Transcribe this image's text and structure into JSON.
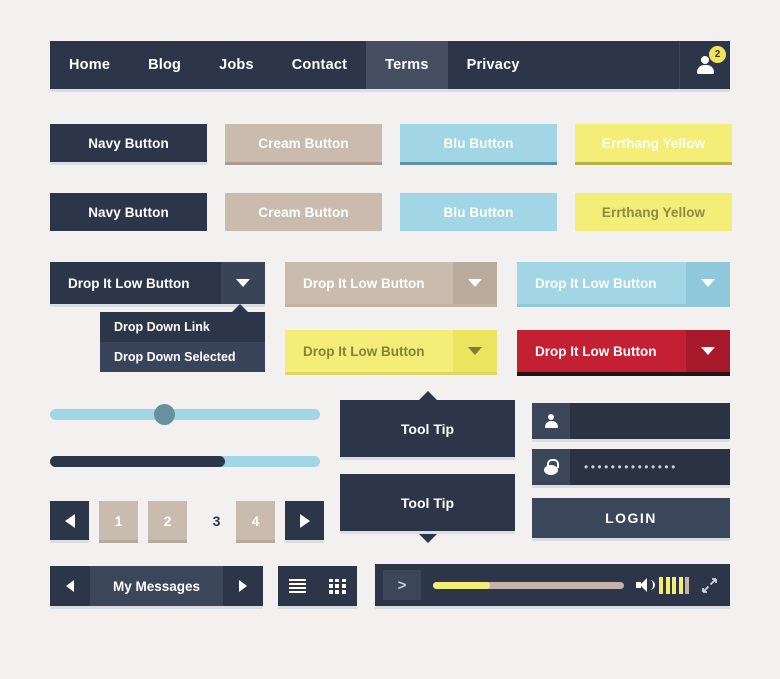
{
  "page": {
    "background": "#f2f1ef",
    "title": "Flat UI Kit"
  },
  "navbar": {
    "background": "#2c3648",
    "active_background": "#454f61",
    "items": [
      {
        "label": "Home",
        "active": false
      },
      {
        "label": "Blog",
        "active": false
      },
      {
        "label": "Jobs",
        "active": false
      },
      {
        "label": "Contact",
        "active": false
      },
      {
        "label": "Terms",
        "active": true
      },
      {
        "label": "Privacy",
        "active": false
      }
    ],
    "avatar": {
      "icon": "user-icon",
      "badge_count": "2",
      "badge_color": "#f2e35d"
    }
  },
  "buttons_row_one": [
    {
      "label": "Navy Button",
      "color": "#2c3648",
      "text_color": "#ffffff"
    },
    {
      "label": "Cream Button",
      "color": "#c9bcae",
      "text_color": "#ffffff"
    },
    {
      "label": "Blu Button",
      "color": "#a3d6e4",
      "text_color": "#ffffff"
    },
    {
      "label": "Errthang Yellow",
      "color": "#f4ee79",
      "text_color": "#ffffff"
    }
  ],
  "buttons_row_two": [
    {
      "label": "Navy Button",
      "color": "#2c3648",
      "text_color": "#ffffff"
    },
    {
      "label": "Cream Button",
      "color": "#c9bcae",
      "text_color": "#ffffff"
    },
    {
      "label": "Blu Button",
      "color": "#a3d6e4",
      "text_color": "#ffffff"
    },
    {
      "label": "Errthang Yellow",
      "color": "#f4ee79",
      "text_color": "#8d8b42"
    }
  ],
  "dropdown_buttons": [
    {
      "label": "Drop It Low Button",
      "color": "#2c3648",
      "caret": "chevron-down-icon"
    },
    {
      "label": "Drop It Low Button",
      "color": "#c9bcae",
      "caret": "chevron-down-icon"
    },
    {
      "label": "Drop It Low Button",
      "color": "#a3d6e4",
      "caret": "chevron-down-icon"
    },
    {
      "label": "Drop It Low Button",
      "color": "#f4ee79",
      "caret": "chevron-down-icon"
    },
    {
      "label": "Drop It Low Button",
      "color": "#c42033",
      "caret": "chevron-down-icon"
    }
  ],
  "dropdown_menu": {
    "items": [
      {
        "label": "Drop Down Link",
        "selected": false
      },
      {
        "label": "Drop Down Selected",
        "selected": true
      }
    ]
  },
  "sliders": [
    {
      "name": "handle-slider",
      "value_percent": 44,
      "track_color": "#a3d6e4",
      "handle_color": "#68909d"
    },
    {
      "name": "progress-slider",
      "value_percent": 65,
      "track_color": "#a3d6e4",
      "fill_color": "#2c3648"
    }
  ],
  "pagination": {
    "prev_icon": "triangle-left-icon",
    "next_icon": "triangle-right-icon",
    "pages": [
      {
        "label": "1",
        "style": "cream"
      },
      {
        "label": "2",
        "style": "cream"
      },
      {
        "label": "3",
        "style": "plain"
      },
      {
        "label": "4",
        "style": "cream"
      }
    ]
  },
  "tooltips": [
    {
      "label": "Tool Tip",
      "arrow": "up"
    },
    {
      "label": "Tool Tip",
      "arrow": "down"
    }
  ],
  "login": {
    "username": {
      "icon": "user-icon",
      "value": "",
      "placeholder": ""
    },
    "password": {
      "icon": "lock-icon",
      "value": "••••••••••••••"
    },
    "submit_label": "LOGIN"
  },
  "messages_bar": {
    "label": "My Messages",
    "prev_icon": "triangle-left-icon",
    "next_icon": "triangle-right-icon"
  },
  "view_toggle": [
    {
      "icon": "list-view-icon"
    },
    {
      "icon": "grid-view-icon"
    }
  ],
  "media_player": {
    "play_label": ">",
    "play_icon": "play-icon",
    "progress_percent": 30,
    "progress_color": "#f4ee79",
    "track_color": "#c3b3a8",
    "speaker_icon": "speaker-icon",
    "volume_level": 4,
    "volume_total": 5,
    "fullscreen_icon": "fullscreen-icon"
  }
}
